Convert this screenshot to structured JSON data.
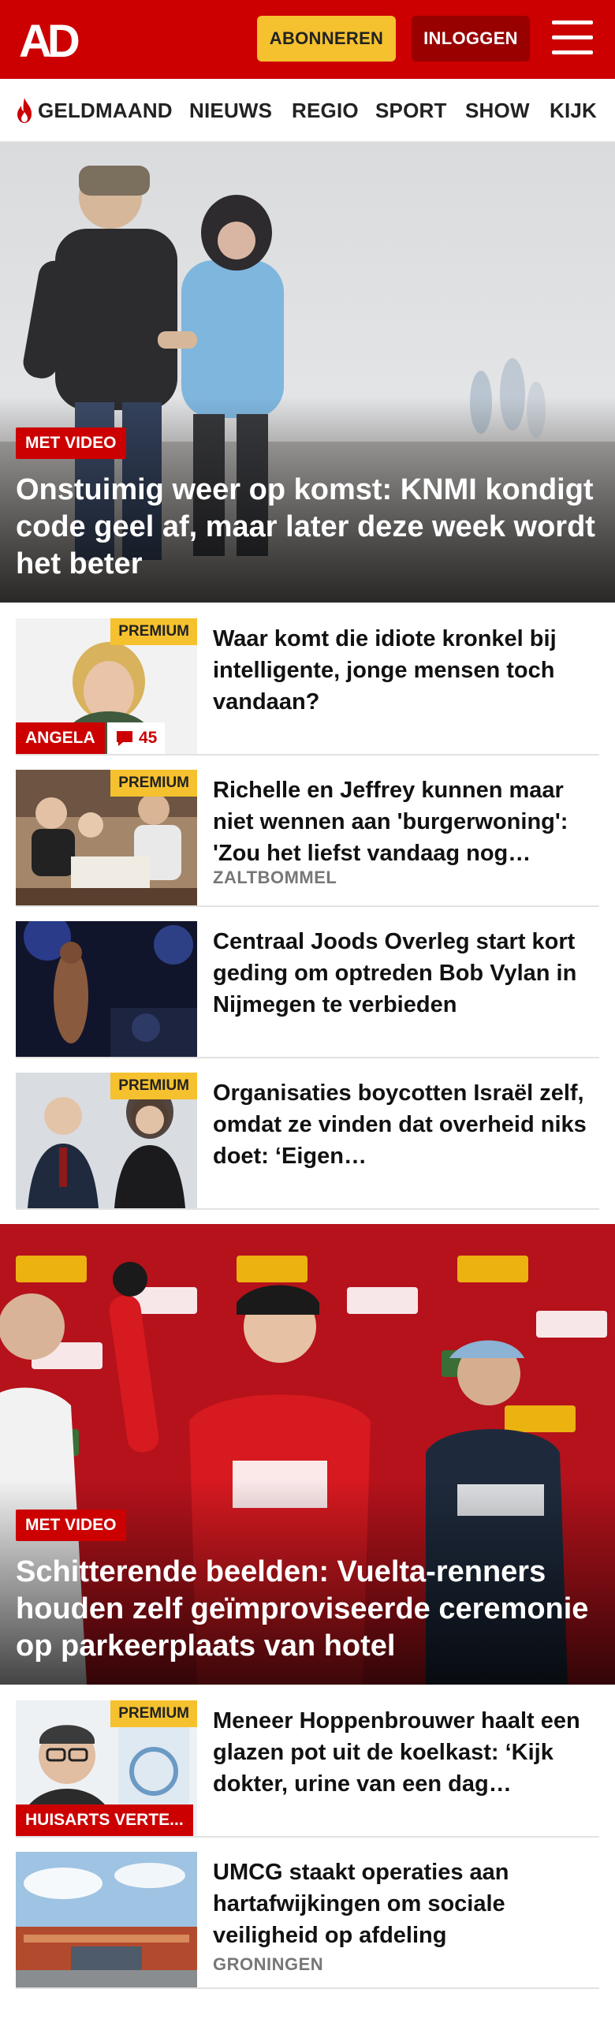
{
  "header": {
    "logo_text": "AD",
    "subscribe_label": "ABONNEREN",
    "login_label": "INLOGGEN",
    "menu_icon": "hamburger-menu-icon"
  },
  "nav": {
    "items": [
      {
        "label": "GELDMAAND",
        "icon": "flame-icon"
      },
      {
        "label": "NIEUWS"
      },
      {
        "label": "REGIO"
      },
      {
        "label": "SPORT"
      },
      {
        "label": "SHOW"
      },
      {
        "label": "KIJK"
      }
    ]
  },
  "hero1": {
    "badge": "MET VIDEO",
    "title": "Onstuimig weer op komst: KNMI kondigt code geel af, maar later deze week wordt het beter"
  },
  "articles1": [
    {
      "premium": "PREMIUM",
      "title": "Waar komt die idiote kronkel bij intelligente, jonge mensen toch vandaan?",
      "tag": "ANGELA",
      "comments": "45",
      "comment_icon": "comment-bubble-icon"
    },
    {
      "premium": "PREMIUM",
      "title": "Richelle en Jeffrey kunnen maar niet wennen aan 'burgerwoning': 'Zou het liefst vandaag nog…",
      "location": "ZALTBOMMEL"
    },
    {
      "title": "Centraal Joods Overleg start kort geding om optreden Bob Vylan in Nijmegen te verbieden"
    },
    {
      "premium": "PREMIUM",
      "title": "Organisaties boycotten Israël zelf, omdat ze vinden dat overheid niks doet: ‘Eigen…"
    }
  ],
  "hero2": {
    "badge": "MET VIDEO",
    "title": "Schitterende beelden: Vuelta-renners houden zelf geïmproviseerde ceremonie op parkeerplaats van hotel"
  },
  "articles2": [
    {
      "premium": "PREMIUM",
      "title": "Meneer Hoppenbrouwer haalt een glazen pot uit de koelkast: ‘Kijk dokter, urine van een dag…",
      "tag": "HUISARTS VERTE..."
    },
    {
      "title": "UMCG staakt operaties aan hartafwijkingen om sociale veiligheid op afdeling",
      "location": "GRONINGEN"
    }
  ],
  "colors": {
    "brand_red": "#cc0000",
    "premium_yellow": "#f5c12e",
    "login_dark_red": "#990000"
  }
}
